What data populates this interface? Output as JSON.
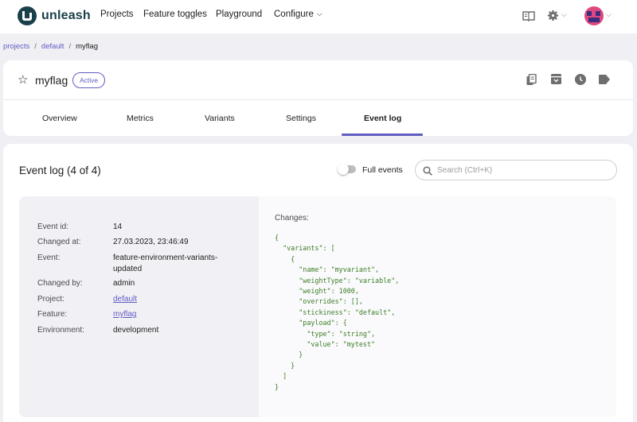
{
  "app": {
    "name": "unleash"
  },
  "nav": {
    "items": [
      {
        "label": "Projects"
      },
      {
        "label": "Feature toggles"
      },
      {
        "label": "Playground"
      },
      {
        "label": "Configure"
      }
    ]
  },
  "icons": {
    "docs": "book-icon",
    "settings": "gear-icon",
    "user": "avatar",
    "star": "star-outline-icon",
    "copy": "copy-icon",
    "archive": "archive-icon",
    "history": "clock-icon",
    "tags": "tag-icon",
    "search": "search-icon"
  },
  "breadcrumb": {
    "items": [
      "projects",
      "default"
    ],
    "current": "myflag"
  },
  "feature": {
    "name": "myflag",
    "status": "Active",
    "tabs": [
      {
        "label": "Overview"
      },
      {
        "label": "Metrics"
      },
      {
        "label": "Variants"
      },
      {
        "label": "Settings"
      },
      {
        "label": "Event log",
        "active": true
      }
    ]
  },
  "event_log": {
    "title": "Event log (4 of 4)",
    "full_events_label": "Full events",
    "full_events_enabled": false,
    "search_placeholder": "Search (Ctrl+K)",
    "event": {
      "fields": [
        {
          "label": "Event id:",
          "value": "14"
        },
        {
          "label": "Changed at:",
          "value": "27.03.2023, 23:46:49"
        },
        {
          "label": "Event:",
          "value": "feature-environment-variants-updated"
        },
        {
          "label": "Changed by:",
          "value": "admin"
        },
        {
          "label": "Project:",
          "value": "default",
          "link": true
        },
        {
          "label": "Feature:",
          "value": "myflag",
          "link": true
        },
        {
          "label": "Environment:",
          "value": "development"
        }
      ],
      "changes_title": "Changes:",
      "changes_json": "{\n  \"variants\": [\n    {\n      \"name\": \"myvariant\",\n      \"weightType\": \"variable\",\n      \"weight\": 1000,\n      \"overrides\": [],\n      \"stickiness\": \"default\",\n      \"payload\": {\n        \"type\": \"string\",\n        \"value\": \"mytest\"\n      }\n    }\n  ]\n}"
    }
  },
  "colors": {
    "primary": "#615bc2",
    "logo": "#1a4049",
    "json_text": "#3b7d23",
    "background": "#f0f0f4"
  }
}
